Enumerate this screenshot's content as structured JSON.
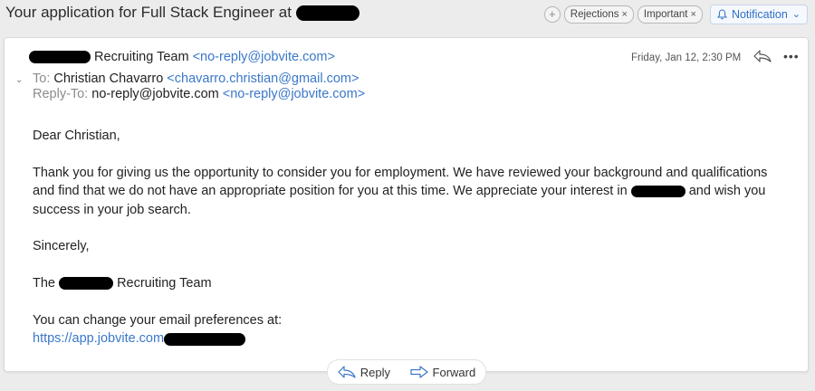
{
  "subject": {
    "text": "Your application for Full Stack Engineer at"
  },
  "tags": [
    {
      "label": "Rejections",
      "remove": "×"
    },
    {
      "label": "Important",
      "remove": "×"
    }
  ],
  "add_tag_symbol": "+",
  "notification": {
    "label": "Notification",
    "chevron": "⌄"
  },
  "message": {
    "from_name": "Recruiting Team",
    "from_email": "<no-reply@jobvite.com>",
    "date": "Friday, Jan 12, 2:30 PM",
    "more_symbol": "•••",
    "to_label": "To:",
    "to_name": "Christian Chavarro",
    "to_email": "<chavarro.christian@gmail.com>",
    "reply_to_label": "Reply-To:",
    "reply_to_name": "no-reply@jobvite.com",
    "reply_to_email": "<no-reply@jobvite.com>",
    "greeting": "Dear Christian,",
    "para1_a": "Thank you for giving us the opportunity to consider you for employment. We have reviewed your background and qualifications and find that we do not have an appropriate position for you at this time. We appreciate your interest in",
    "para1_b": "and wish you success in your job search.",
    "closing": "Sincerely,",
    "signature_a": "The",
    "signature_b": "Recruiting Team",
    "prefs_text": "You can change your email preferences at:",
    "prefs_link": "https://app.jobvite.com"
  },
  "actions": {
    "reply": "Reply",
    "forward": "Forward"
  },
  "colors": {
    "link": "#3a78c9",
    "accent": "#2f6fc8",
    "background": "#ececec"
  }
}
